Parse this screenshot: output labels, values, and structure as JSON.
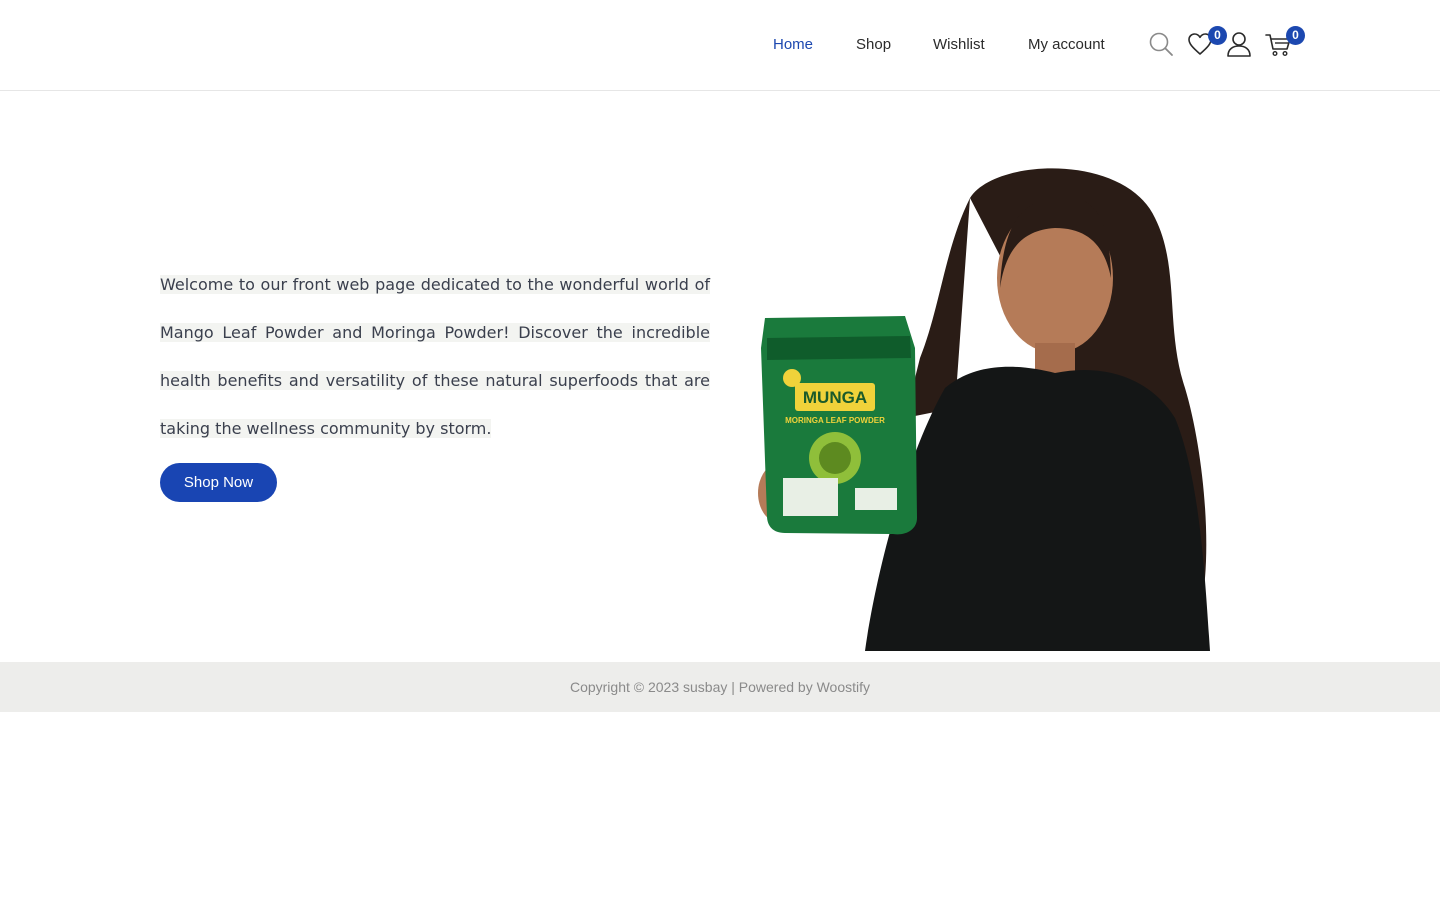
{
  "nav": {
    "items": [
      {
        "label": "Home",
        "active": true
      },
      {
        "label": "Shop",
        "active": false
      },
      {
        "label": "Wishlist",
        "active": false
      },
      {
        "label": "My account",
        "active": false
      }
    ]
  },
  "header_icons": {
    "search": "search-icon",
    "wishlist": "heart-icon",
    "account": "user-icon",
    "cart": "cart-icon",
    "wishlist_count": "0",
    "cart_count": "0"
  },
  "hero": {
    "text": "Welcome to our front web page dedicated to the wonderful world of Mango Leaf Powder and Moringa Powder! Discover the incredible health benefits and versatility of these natural superfoods that are taking the wellness community by storm.",
    "button_label": "Shop Now",
    "product_brand": "MUNGA",
    "product_name": "MORINGA LEAF POWDER"
  },
  "footer": {
    "text": "Copyright © 2023 susbay | Powered by Woostify"
  },
  "colors": {
    "accent": "#1c48b0",
    "footer_bg": "#ededeb"
  }
}
